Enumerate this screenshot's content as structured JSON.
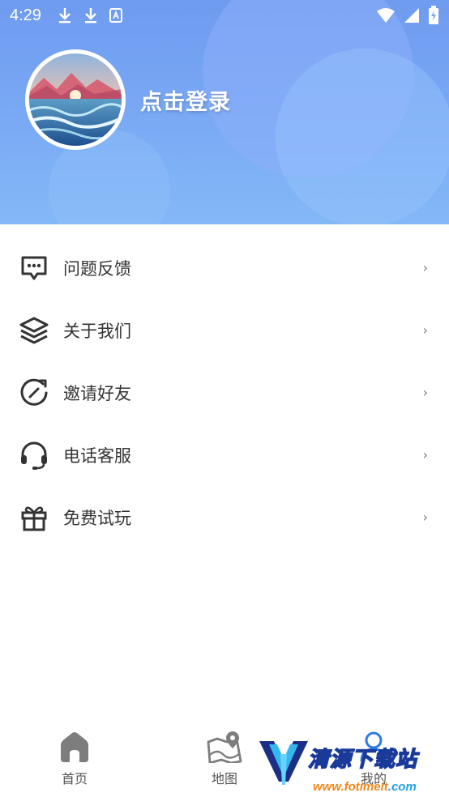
{
  "status_bar": {
    "time": "4:29",
    "left_icons": [
      "download-icon",
      "download-icon",
      "keyboard-icon"
    ],
    "right_icons": [
      "wifi-icon",
      "signal-icon",
      "battery-icon"
    ]
  },
  "header": {
    "login_text": "点击登录",
    "avatar": "landscape-avatar"
  },
  "menu": {
    "items": [
      {
        "label": "问题反馈",
        "icon": "message-dots-icon"
      },
      {
        "label": "关于我们",
        "icon": "layers-icon"
      },
      {
        "label": "邀请好友",
        "icon": "refresh-arrow-icon"
      },
      {
        "label": "电话客服",
        "icon": "headset-icon"
      },
      {
        "label": "免费试玩",
        "icon": "gift-icon"
      }
    ],
    "chevron": "›"
  },
  "bottom_nav": {
    "items": [
      {
        "label": "首页",
        "icon": "home-icon"
      },
      {
        "label": "地图",
        "icon": "map-icon"
      },
      {
        "label": "我的",
        "icon": "person-icon"
      }
    ]
  },
  "watermark": {
    "text": "清源下载站",
    "url_part1": "www.fotimeit",
    "url_part2": ".com"
  },
  "colors": {
    "header_top": "#6f9bf0",
    "header_bottom": "#83b8f7",
    "icon_dark": "#333333",
    "nav_icon": "#7d7d7d"
  }
}
